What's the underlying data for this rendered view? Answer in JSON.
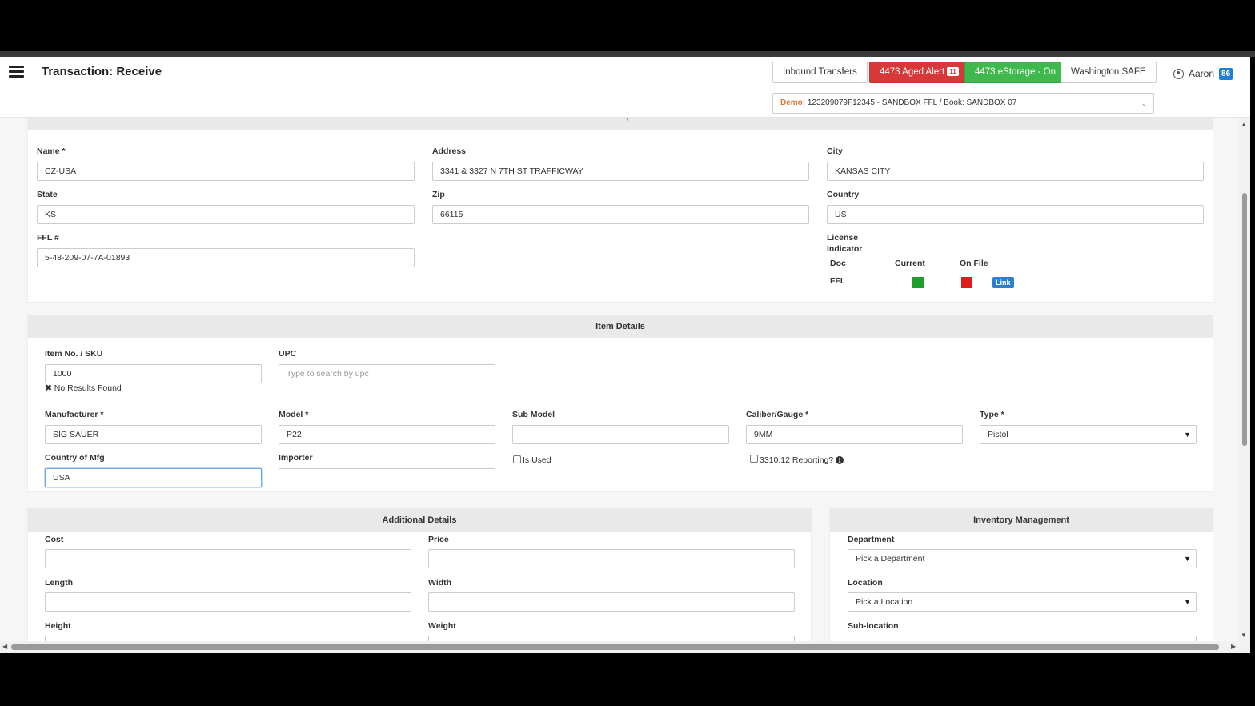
{
  "header": {
    "title": "Transaction: Receive",
    "buttons": {
      "inbound": "Inbound Transfers",
      "aged_alert": "4473 Aged Alert",
      "aged_alert_count": "11",
      "estorage": "4473 eStorage - On",
      "washington": "Washington SAFE"
    },
    "user": {
      "name": "Aaron",
      "badge": "86"
    },
    "license_select": {
      "prefix": "Demo:",
      "value": "123209079F12345 - SANDBOX FFL / Book: SANDBOX 07"
    }
  },
  "acquire_from": {
    "section_title": "Receive / Acquire From",
    "fields": {
      "name": {
        "label": "Name *",
        "value": "CZ-USA"
      },
      "address": {
        "label": "Address",
        "value": "3341 & 3327 N 7TH ST TRAFFICWAY"
      },
      "city": {
        "label": "City",
        "value": "KANSAS CITY"
      },
      "state": {
        "label": "State",
        "value": "KS"
      },
      "zip": {
        "label": "Zip",
        "value": "66115"
      },
      "country": {
        "label": "Country",
        "value": "US"
      },
      "ffl": {
        "label": "FFL #",
        "value": "5-48-209-07-7A-01893"
      }
    },
    "license_indicator": {
      "label_line1": "License",
      "label_line2": "Indicator",
      "col_doc": "Doc",
      "col_current": "Current",
      "col_on_file": "On File",
      "row_doc": "FFL",
      "current_color": "#1e9e2a",
      "on_file_color": "#e01b1b",
      "link_label": "Link"
    }
  },
  "item_details": {
    "title": "Item Details",
    "sku": {
      "label": "Item No. / SKU",
      "value": "1000",
      "note": "No Results Found"
    },
    "upc": {
      "label": "UPC",
      "placeholder": "Type to search by upc"
    },
    "manufacturer": {
      "label": "Manufacturer *",
      "value": "SIG SAUER"
    },
    "model": {
      "label": "Model *",
      "value": "P22"
    },
    "sub_model": {
      "label": "Sub Model",
      "value": ""
    },
    "caliber": {
      "label": "Caliber/Gauge *",
      "value": "9MM"
    },
    "type": {
      "label": "Type *",
      "value": "Pistol"
    },
    "country_mfg": {
      "label": "Country of Mfg",
      "value": "USA"
    },
    "importer": {
      "label": "Importer",
      "value": ""
    },
    "is_used": {
      "label": "Is Used"
    },
    "reporting": {
      "label": "3310.12 Reporting?"
    }
  },
  "additional_details": {
    "title": "Additional Details",
    "cost": {
      "label": "Cost"
    },
    "price": {
      "label": "Price"
    },
    "length": {
      "label": "Length"
    },
    "width": {
      "label": "Width"
    },
    "height": {
      "label": "Height"
    },
    "weight": {
      "label": "Weight"
    }
  },
  "inventory_management": {
    "title": "Inventory Management",
    "department": {
      "label": "Department",
      "value": "Pick a Department"
    },
    "location": {
      "label": "Location",
      "value": "Pick a Location"
    },
    "sub_location": {
      "label": "Sub-location"
    }
  }
}
